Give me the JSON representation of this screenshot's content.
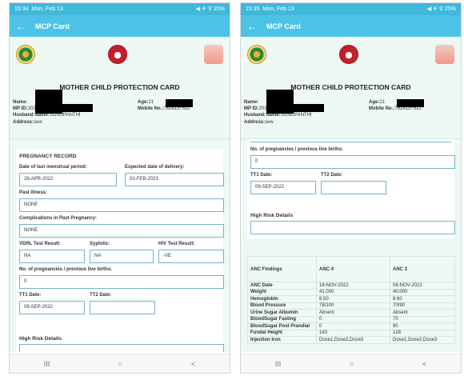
{
  "left": {
    "status": {
      "time": "15:34",
      "date": "Mon, Feb 13",
      "right": "◀ ✈ ⚲ 25%"
    },
    "appbar": {
      "title": "MCP Card"
    },
    "header": {
      "title": "MOTHER CHILD PROTECTION CARD",
      "name_label": "Name:",
      "mp_label": "MP ID:",
      "mp_value": "20223387",
      "husband_label": "Husband Name:",
      "husband_value": "SONUPANTHI",
      "address_label": "Address:",
      "address_value": "sew",
      "age_label": "Age:",
      "age_value": "21",
      "mobile_label": "Mobile No.:",
      "mobile_value": "7828137512"
    },
    "pregnancy": {
      "title": "PREGNANCY RECORD",
      "lmp_label": "Date of last menstrual period:",
      "lmp_value": "28-APR-2022",
      "edd_label": "Expected date of delivery:",
      "edd_value": "02-FEB-2023",
      "illness_label": "Past Illness:",
      "illness_value": "NONE",
      "complications_label": "Complications in Past Pregnancy:",
      "complications_value": "NONE",
      "vdrl_label": "VDRL Test Result:",
      "vdrl_value": "NA",
      "syphilis_label": "Syphilis:",
      "syphilis_value": "NA",
      "hiv_label": "HIV Test Result:",
      "hiv_value": "-VE",
      "prev_births_label": "No. of pregnancies / previous live births:",
      "prev_births_value": "0",
      "tt1_label": "TT1 Date:",
      "tt1_value": "09-SEP-2022",
      "tt2_label": "TT2 Date:",
      "tt2_value": "",
      "high_risk_label": "High Risk Details"
    },
    "nav": {
      "recent": "III",
      "home": "○",
      "back": "<"
    }
  },
  "right": {
    "status": {
      "time": "15:35",
      "date": "Mon, Feb 13",
      "right": "◀ ✈ ⚲ 25%"
    },
    "appbar": {
      "title": "MCP Card"
    },
    "header": {
      "title": "MOTHER CHILD PROTECTION CARD",
      "name_label": "Name:",
      "mp_label": "MP ID:",
      "mp_value": "20223387",
      "husband_label": "Husband Name:",
      "husband_value": "SONUPANTHI",
      "address_label": "Address:",
      "address_value": "sew",
      "age_label": "Age:",
      "age_value": "21",
      "mobile_label": "Mobile No.:",
      "mobile_value": "7828137512"
    },
    "form": {
      "prev_births_label": "No. of pregnancies / previous live births:",
      "prev_births_value": "0",
      "tt1_label": "TT1 Date:",
      "tt1_value": "09-SEP-2022",
      "tt2_label": "TT2 Date:",
      "tt2_value": "",
      "high_risk_label": "High Risk Details"
    },
    "anc": {
      "headers": [
        "ANC Findings",
        "ANC 4",
        "ANC 3"
      ],
      "rows": [
        [
          "ANC Date",
          "18-NOV-2022",
          "08-NOV-2022"
        ],
        [
          "Weight",
          "41.000",
          "40.000"
        ],
        [
          "Hemoglobin",
          "8.50",
          "8.60"
        ],
        [
          "Blood Pressure",
          "78/100",
          "70/90"
        ],
        [
          "Urine Sugar Albumin",
          "Absent",
          "Absent"
        ],
        [
          "BloodSugar Fasting",
          "0",
          "70"
        ],
        [
          "BloodSugar Post Prandial",
          "0",
          "90"
        ],
        [
          "Fundal Height",
          "143",
          "128"
        ],
        [
          "Injection Iron",
          "Dose1,Dose2,Dose3",
          "Dose1,Dose2,Dose3"
        ]
      ]
    },
    "nav": {
      "recent": "III",
      "home": "○",
      "back": "<"
    }
  }
}
